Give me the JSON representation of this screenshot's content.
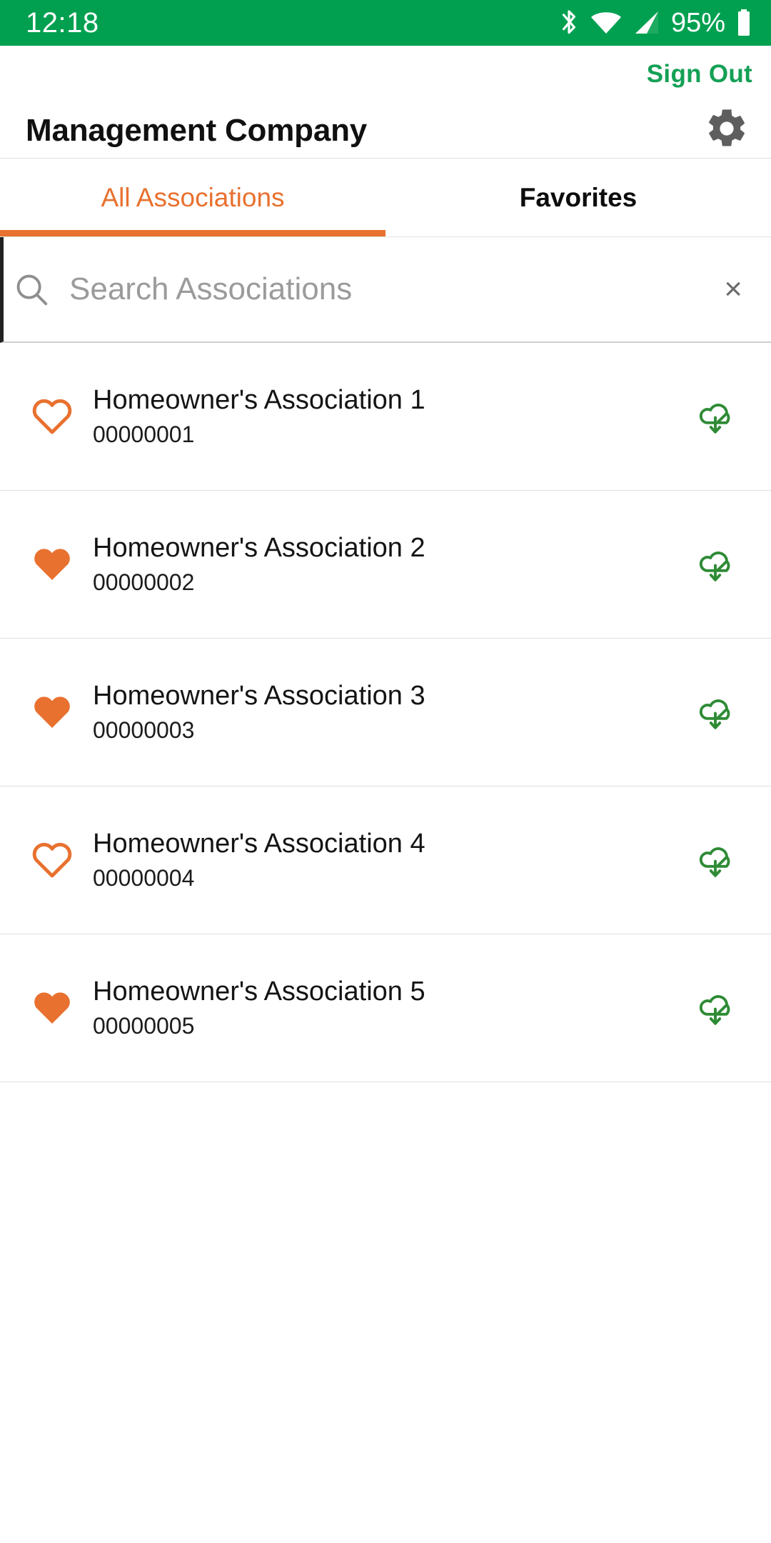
{
  "status_bar": {
    "time": "12:18",
    "battery_percent": "95%",
    "icons": [
      "bluetooth-icon",
      "wifi-icon",
      "cellular-signal-icon",
      "battery-icon"
    ],
    "background_color": "#00a050",
    "foreground_color": "#ffffff"
  },
  "header": {
    "sign_out_label": "Sign Out",
    "sign_out_color": "#14a055",
    "title": "Management Company",
    "settings_icon": "gear-icon"
  },
  "tabs": {
    "active_index": 0,
    "accent_color": "#e8712f",
    "items": [
      {
        "label": "All Associations",
        "active": true
      },
      {
        "label": "Favorites",
        "active": false
      }
    ]
  },
  "search": {
    "placeholder": "Search Associations",
    "value": "",
    "search_icon": "search-icon",
    "clear_icon": "close-icon",
    "clear_label": "×"
  },
  "list": {
    "favorite_color": "#e8712f",
    "download_color": "#2e8b35",
    "rows": [
      {
        "title": "Homeowner's Association 1",
        "id": "00000001",
        "favorite": false,
        "download_icon": "cloud-download-icon"
      },
      {
        "title": "Homeowner's Association 2",
        "id": "00000002",
        "favorite": true,
        "download_icon": "cloud-download-icon"
      },
      {
        "title": "Homeowner's Association 3",
        "id": "00000003",
        "favorite": true,
        "download_icon": "cloud-download-icon"
      },
      {
        "title": "Homeowner's Association 4",
        "id": "00000004",
        "favorite": false,
        "download_icon": "cloud-download-icon"
      },
      {
        "title": "Homeowner's Association 5",
        "id": "00000005",
        "favorite": true,
        "download_icon": "cloud-download-icon"
      }
    ]
  }
}
